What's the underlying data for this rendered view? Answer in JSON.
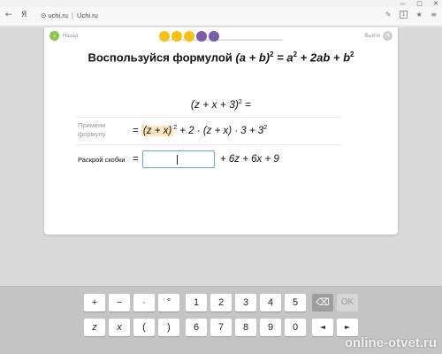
{
  "browser": {
    "back_glyph": "←",
    "yandex_glyph": "Я",
    "lock_glyph": "⊙",
    "address_host": "uchi.ru",
    "address_title": "Uchi.ru",
    "address_sep": "|",
    "win_minimize": "—",
    "win_maximize": "□",
    "win_close": "✕",
    "icon_edit": "✎",
    "icon_ext": "1",
    "icon_star": "★",
    "icon_menu": "≡"
  },
  "lesson": {
    "back_label": "Назад",
    "exit_label": "Выйти",
    "progress": {
      "active_index": 4,
      "dots": [
        "#f5c211",
        "#f5c211",
        "#f5c211",
        "#7a5ca8",
        "#7a5ca8"
      ]
    },
    "title": {
      "prefix": "Воспользуйся формулой ",
      "lhs": "(a + b)",
      "lhs_exp": "2",
      "eq": " = a",
      "a_exp": "2",
      "mid": " + 2ab + b",
      "b_exp": "2"
    },
    "expression": {
      "base": "(z + x + 3)",
      "exp": "2",
      "tail": " ="
    },
    "apply": {
      "label": "Примени формулу",
      "eq": "= ",
      "highlight": "(z + x)",
      "highlight_exp": "2",
      "rest": " + 2 · (z + x) · 3 + 3",
      "rest_exp": "2"
    },
    "open": {
      "label": "Раскрой скобки",
      "eq": "=",
      "input_value": "",
      "rest": "+   6z + 6x   +   9"
    }
  },
  "keyboard": {
    "row1": [
      "+",
      "−",
      "·",
      "°",
      "1",
      "2",
      "3",
      "4",
      "5",
      "⌫",
      "OK"
    ],
    "row2": [
      "z",
      "x",
      "(",
      ")",
      "6",
      "7",
      "8",
      "9",
      "0",
      "◄",
      "►"
    ]
  },
  "watermark": "online-otvet.ru"
}
